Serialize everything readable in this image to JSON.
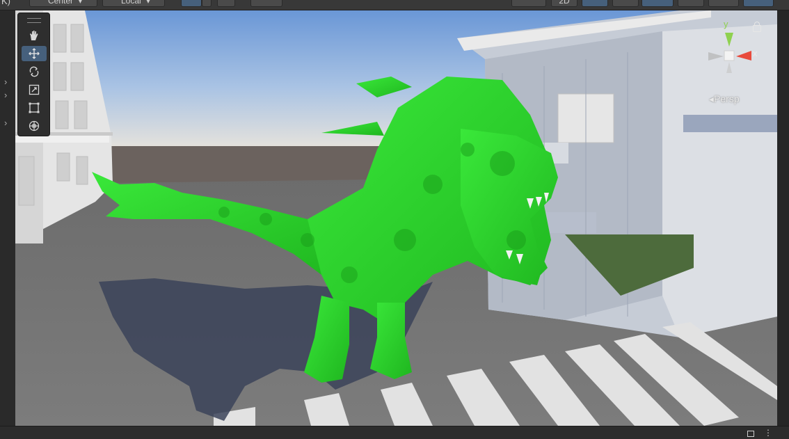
{
  "toolbar": {
    "left_cut_text": "K)",
    "pivot_label": "Center",
    "space_label": "Local",
    "mode_2d_label": "2D"
  },
  "tools": [
    {
      "name": "hand-tool",
      "icon": "hand-icon",
      "active": false
    },
    {
      "name": "move-tool",
      "icon": "move-icon",
      "active": true
    },
    {
      "name": "rotate-tool",
      "icon": "rotate-icon",
      "active": false
    },
    {
      "name": "scale-tool",
      "icon": "scale-icon",
      "active": false
    },
    {
      "name": "rect-tool",
      "icon": "rect-icon",
      "active": false
    },
    {
      "name": "transform-tool",
      "icon": "transform-icon",
      "active": false
    }
  ],
  "gizmo": {
    "y_label": "y",
    "x_label": "x",
    "projection_label": "Persp",
    "colors": {
      "x": "#e84a3c",
      "y": "#8fd14f"
    }
  },
  "scene": {
    "creature_color": "#2fd62f",
    "ground_color": "#7a7a7a",
    "sky_top": "#6a97d6",
    "sky_horizon": "#e7e3dc"
  }
}
